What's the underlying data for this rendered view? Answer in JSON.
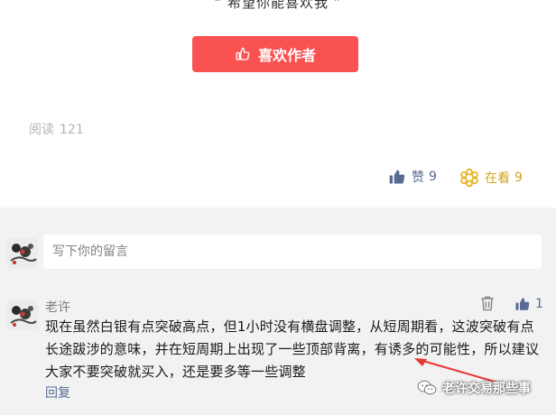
{
  "article": {
    "quote": "“ 希望你能喜欢我 ”",
    "like_author_label": "喜欢作者",
    "read_label": "阅读",
    "read_count": "121",
    "zan_label": "赞",
    "zan_count": "9",
    "kan_label": "在看",
    "kan_count": "9"
  },
  "comment_input": {
    "placeholder": "写下你的留言"
  },
  "comment": {
    "nickname": "老许",
    "content": "现在虽然白银有点突破高点，但1小时没有横盘调整，从短周期看，这波突破有点长途跋涉的意味，并在短周期上出现了一些顶部背离，有诱多的可能性，所以建议大家不要突破就买入，还是要多等一些调整",
    "reply_label": "回复",
    "like_count": "1"
  },
  "watermark": {
    "text": "老许交易那些事"
  },
  "colors": {
    "accent_red": "#fa5151",
    "link_blue": "#576b95",
    "gold": "#d5a323",
    "comment_bg": "#f2f2f2"
  },
  "icons": {
    "like_author": "thumbs-up-outline-icon",
    "zan": "thumbs-up-icon",
    "kan": "flower-icon",
    "delete": "trash-icon",
    "comment_like": "thumbs-up-icon",
    "watermark": "wechat-icon"
  }
}
